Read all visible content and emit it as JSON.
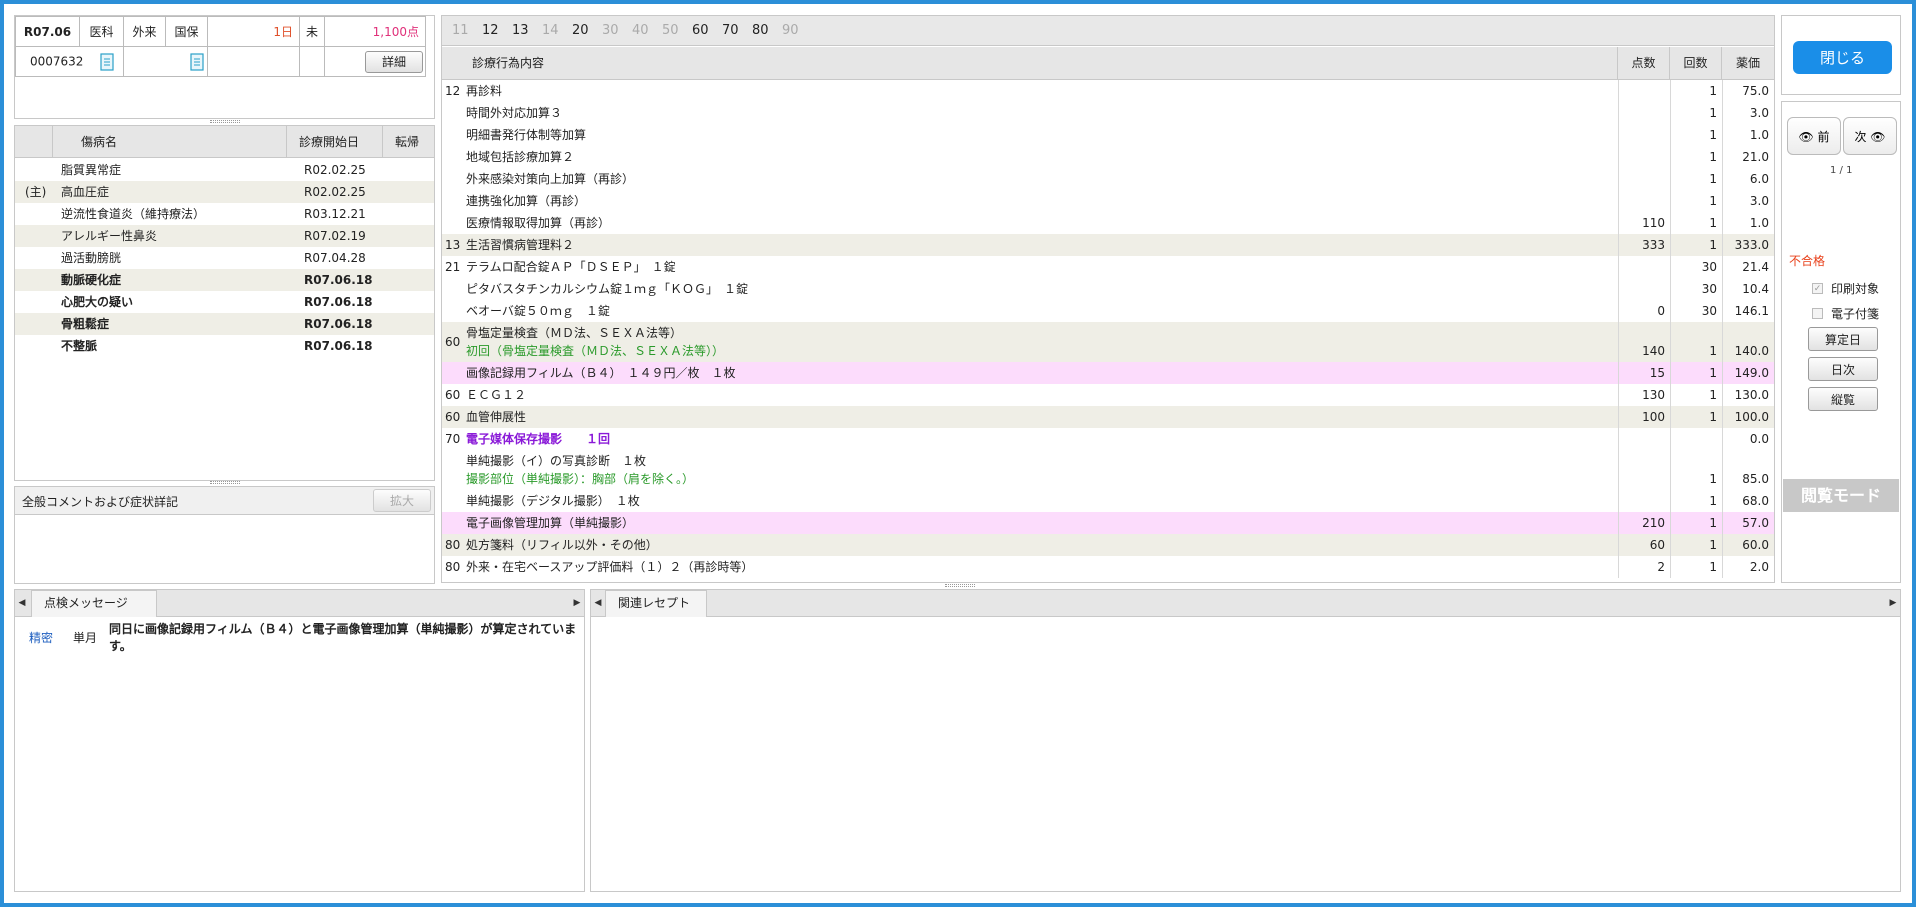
{
  "header": {
    "date": "R07.06",
    "dept": "医科",
    "visit_type": "外来",
    "insurance": "国保",
    "days": "1日",
    "status": "未",
    "points": "1,100点",
    "patient_id": "0007632",
    "detail_button": "詳細"
  },
  "disease": {
    "columns": [
      "傷病名",
      "診療開始日",
      "転帰"
    ],
    "rows": [
      {
        "prefix": "",
        "name": "脂質異常症",
        "date": "R02.02.25",
        "outcome": "",
        "bold": false
      },
      {
        "prefix": "(主)",
        "name": "高血圧症",
        "date": "R02.02.25",
        "outcome": "",
        "bold": false
      },
      {
        "prefix": "",
        "name": "逆流性食道炎（維持療法）",
        "date": "R03.12.21",
        "outcome": "",
        "bold": false
      },
      {
        "prefix": "",
        "name": "アレルギー性鼻炎",
        "date": "R07.02.19",
        "outcome": "",
        "bold": false
      },
      {
        "prefix": "",
        "name": "過活動膀胱",
        "date": "R07.04.28",
        "outcome": "",
        "bold": false
      },
      {
        "prefix": "",
        "name": "動脈硬化症",
        "date": "R07.06.18",
        "outcome": "",
        "bold": true
      },
      {
        "prefix": "",
        "name": "心肥大の疑い",
        "date": "R07.06.18",
        "outcome": "",
        "bold": true
      },
      {
        "prefix": "",
        "name": "骨粗鬆症",
        "date": "R07.06.18",
        "outcome": "",
        "bold": true
      },
      {
        "prefix": "",
        "name": "不整脈",
        "date": "R07.06.18",
        "outcome": "",
        "bold": true
      }
    ]
  },
  "comment": {
    "label": "全般コメントおよび症状詳記",
    "expand_button": "拡大"
  },
  "category_tabs": [
    {
      "label": "11",
      "enabled": false
    },
    {
      "label": "12",
      "enabled": true
    },
    {
      "label": "13",
      "enabled": true
    },
    {
      "label": "14",
      "enabled": false
    },
    {
      "label": "20",
      "enabled": true
    },
    {
      "label": "30",
      "enabled": false
    },
    {
      "label": "40",
      "enabled": false
    },
    {
      "label": "50",
      "enabled": false
    },
    {
      "label": "60",
      "enabled": true
    },
    {
      "label": "70",
      "enabled": true
    },
    {
      "label": "80",
      "enabled": true
    },
    {
      "label": "90",
      "enabled": false
    }
  ],
  "treatment": {
    "columns": {
      "content": "診療行為内容",
      "points": "点数",
      "count": "回数",
      "price": "薬価"
    },
    "rows": [
      {
        "code": "12",
        "lines": [
          {
            "text": "再診料",
            "style": ""
          }
        ],
        "points": "",
        "count": "1",
        "price": "75.0",
        "bg": ""
      },
      {
        "code": "",
        "lines": [
          {
            "text": "時間外対応加算３",
            "style": ""
          }
        ],
        "points": "",
        "count": "1",
        "price": "3.0",
        "bg": ""
      },
      {
        "code": "",
        "lines": [
          {
            "text": "明細書発行体制等加算",
            "style": ""
          }
        ],
        "points": "",
        "count": "1",
        "price": "1.0",
        "bg": ""
      },
      {
        "code": "",
        "lines": [
          {
            "text": "地域包括診療加算２",
            "style": ""
          }
        ],
        "points": "",
        "count": "1",
        "price": "21.0",
        "bg": ""
      },
      {
        "code": "",
        "lines": [
          {
            "text": "外来感染対策向上加算（再診）",
            "style": ""
          }
        ],
        "points": "",
        "count": "1",
        "price": "6.0",
        "bg": ""
      },
      {
        "code": "",
        "lines": [
          {
            "text": "連携強化加算（再診）",
            "style": ""
          }
        ],
        "points": "",
        "count": "1",
        "price": "3.0",
        "bg": ""
      },
      {
        "code": "",
        "lines": [
          {
            "text": "医療情報取得加算（再診）",
            "style": ""
          }
        ],
        "points": "110",
        "count": "1",
        "price": "1.0",
        "bg": ""
      },
      {
        "code": "13",
        "lines": [
          {
            "text": "生活習慣病管理料２",
            "style": ""
          }
        ],
        "points": "333",
        "count": "1",
        "price": "333.0",
        "bg": "alt"
      },
      {
        "code": "21",
        "lines": [
          {
            "text": "テラムロ配合錠ＡＰ「ＤＳＥＰ」　１錠",
            "style": ""
          }
        ],
        "points": "",
        "count": "30",
        "price": "21.4",
        "bg": ""
      },
      {
        "code": "",
        "lines": [
          {
            "text": "ピタバスタチンカルシウム錠１ｍｇ「ＫＯＧ」　１錠",
            "style": ""
          }
        ],
        "points": "",
        "count": "30",
        "price": "10.4",
        "bg": ""
      },
      {
        "code": "",
        "lines": [
          {
            "text": "ベオーバ錠５０ｍｇ　１錠",
            "style": ""
          }
        ],
        "points": "0",
        "count": "30",
        "price": "146.1",
        "bg": ""
      },
      {
        "code": "60",
        "lines": [
          {
            "text": "骨塩定量検査（ＭＤ法、ＳＥＸＡ法等）",
            "style": ""
          },
          {
            "text": "初回（骨塩定量検査（ＭＤ法、ＳＥＸＡ法等））",
            "style": "green"
          }
        ],
        "points": "140",
        "count": "1",
        "price": "140.0",
        "bg": "alt"
      },
      {
        "code": "",
        "lines": [
          {
            "text": "画像記録用フィルム（Ｂ４）　１４９円／枚　１枚",
            "style": ""
          }
        ],
        "points": "15",
        "count": "1",
        "price": "149.0",
        "bg": "pink"
      },
      {
        "code": "60",
        "lines": [
          {
            "text": "ＥＣＧ１２",
            "style": ""
          }
        ],
        "points": "130",
        "count": "1",
        "price": "130.0",
        "bg": ""
      },
      {
        "code": "60",
        "lines": [
          {
            "text": "血管伸展性",
            "style": ""
          }
        ],
        "points": "100",
        "count": "1",
        "price": "100.0",
        "bg": "alt"
      },
      {
        "code": "70",
        "lines": [
          {
            "text": "電子媒体保存撮影　　１回",
            "style": "purple"
          }
        ],
        "points": "",
        "count": "",
        "price": "0.0",
        "bg": ""
      },
      {
        "code": "",
        "lines": [
          {
            "text": "単純撮影（イ）の写真診断　１枚",
            "style": ""
          },
          {
            "text": "撮影部位（単純撮影）：胸部（肩を除く。）",
            "style": "green"
          }
        ],
        "points": "",
        "count": "1",
        "price": "85.0",
        "bg": ""
      },
      {
        "code": "",
        "lines": [
          {
            "text": "単純撮影（デジタル撮影）　１枚",
            "style": ""
          }
        ],
        "points": "",
        "count": "1",
        "price": "68.0",
        "bg": ""
      },
      {
        "code": "",
        "lines": [
          {
            "text": "電子画像管理加算（単純撮影）",
            "style": ""
          }
        ],
        "points": "210",
        "count": "1",
        "price": "57.0",
        "bg": "pink"
      },
      {
        "code": "80",
        "lines": [
          {
            "text": "処方箋料（リフィル以外・その他）",
            "style": ""
          }
        ],
        "points": "60",
        "count": "1",
        "price": "60.0",
        "bg": "alt"
      },
      {
        "code": "80",
        "lines": [
          {
            "text": "外来・在宅ベースアップ評価料（１）２（再診時等）",
            "style": ""
          }
        ],
        "points": "2",
        "count": "1",
        "price": "2.0",
        "bg": ""
      }
    ]
  },
  "side": {
    "close_button": "閉じる",
    "prev_button": "前",
    "next_button": "次",
    "page": "1 / 1",
    "status": "不合格",
    "print_target": "印刷対象",
    "electronic_attach": "電子付箋",
    "calc_date_button": "算定日",
    "daily_button": "日次",
    "overview_button": "縦覧",
    "browse_mode": "閲覧モード"
  },
  "check_panel": {
    "tab_label": "点検メッセージ",
    "message": {
      "level": "精密",
      "period": "単月",
      "text": "同日に画像記録用フィルム（Ｂ４）と電子画像管理加算（単純撮影）が算定されています。"
    }
  },
  "related_panel": {
    "tab_label": "関連レセプト"
  },
  "colors": {
    "frame": "#2b8fd8",
    "close_button": "#1a8ee8",
    "points": "#e0307a",
    "days": "#e0502a",
    "status_fail": "#e8401a",
    "pink_row": "#fcdcfc",
    "alt_row": "#efeee6"
  }
}
